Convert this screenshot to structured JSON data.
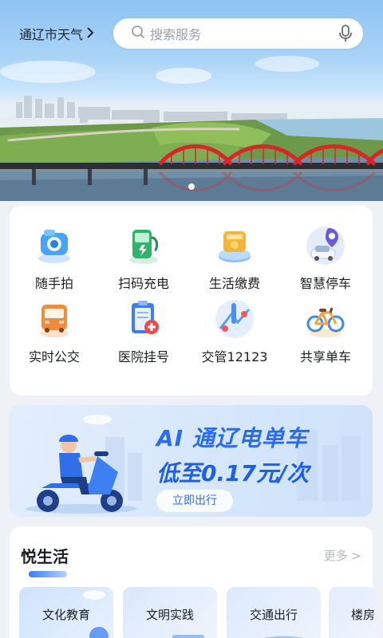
{
  "header": {
    "city_weather": "通辽市天气",
    "search_placeholder": "搜索服务"
  },
  "services": [
    {
      "label": "随手拍",
      "icon": "camera-icon"
    },
    {
      "label": "扫码充电",
      "icon": "charging-pile-icon"
    },
    {
      "label": "生活缴费",
      "icon": "wallet-icon"
    },
    {
      "label": "智慧停车",
      "icon": "parking-car-icon"
    },
    {
      "label": "实时公交",
      "icon": "bus-icon"
    },
    {
      "label": "医院挂号",
      "icon": "hospital-clipboard-icon"
    },
    {
      "label": "交管12123",
      "icon": "traffic-map-icon"
    },
    {
      "label": "共享单车",
      "icon": "bicycle-icon"
    }
  ],
  "banner": {
    "line1": "AI 通辽电单车",
    "line2": "低至0.17元/次",
    "cta": "立即出行"
  },
  "life": {
    "title": "悦生活",
    "more": "更多 >",
    "tiles": [
      "文化教育",
      "文明实践",
      "交通出行",
      "楼房"
    ]
  },
  "colors": {
    "accent": "#2a6cf0",
    "bridge": "#d8262a",
    "background": "#eef1f6"
  }
}
